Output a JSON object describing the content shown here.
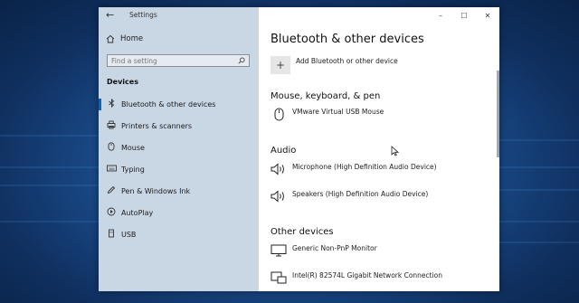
{
  "window": {
    "title": "Settings",
    "controls": {
      "minimize": "–",
      "maximize": "☐",
      "close": "✕"
    }
  },
  "sidebar": {
    "back_glyph": "←",
    "home_label": "Home",
    "search_placeholder": "Find a setting",
    "section_label": "Devices",
    "items": [
      {
        "label": "Bluetooth & other devices",
        "icon": "bluetooth-icon",
        "active": true
      },
      {
        "label": "Printers & scanners",
        "icon": "printer-icon",
        "active": false
      },
      {
        "label": "Mouse",
        "icon": "mouse-icon",
        "active": false
      },
      {
        "label": "Typing",
        "icon": "keyboard-icon",
        "active": false
      },
      {
        "label": "Pen & Windows Ink",
        "icon": "pen-icon",
        "active": false
      },
      {
        "label": "AutoPlay",
        "icon": "autoplay-icon",
        "active": false
      },
      {
        "label": "USB",
        "icon": "usb-icon",
        "active": false
      }
    ]
  },
  "main": {
    "page_title": "Bluetooth & other devices",
    "add_button_label": "Add Bluetooth or other device",
    "groups": [
      {
        "title": "Mouse, keyboard, & pen",
        "devices": [
          {
            "label": "VMware Virtual USB Mouse",
            "icon": "mouse-icon"
          }
        ]
      },
      {
        "title": "Audio",
        "devices": [
          {
            "label": "Microphone (High Definition Audio Device)",
            "icon": "speaker-icon"
          },
          {
            "label": "Speakers (High Definition Audio Device)",
            "icon": "speaker-icon"
          }
        ]
      },
      {
        "title": "Other devices",
        "devices": [
          {
            "label": "Generic Non-PnP Monitor",
            "icon": "monitor-icon"
          },
          {
            "label": "Intel(R) 82574L Gigabit Network Connection",
            "icon": "network-icon"
          }
        ]
      }
    ]
  },
  "colors": {
    "accent": "#0067c0",
    "sidebar_bg": "#c9d6e4"
  }
}
